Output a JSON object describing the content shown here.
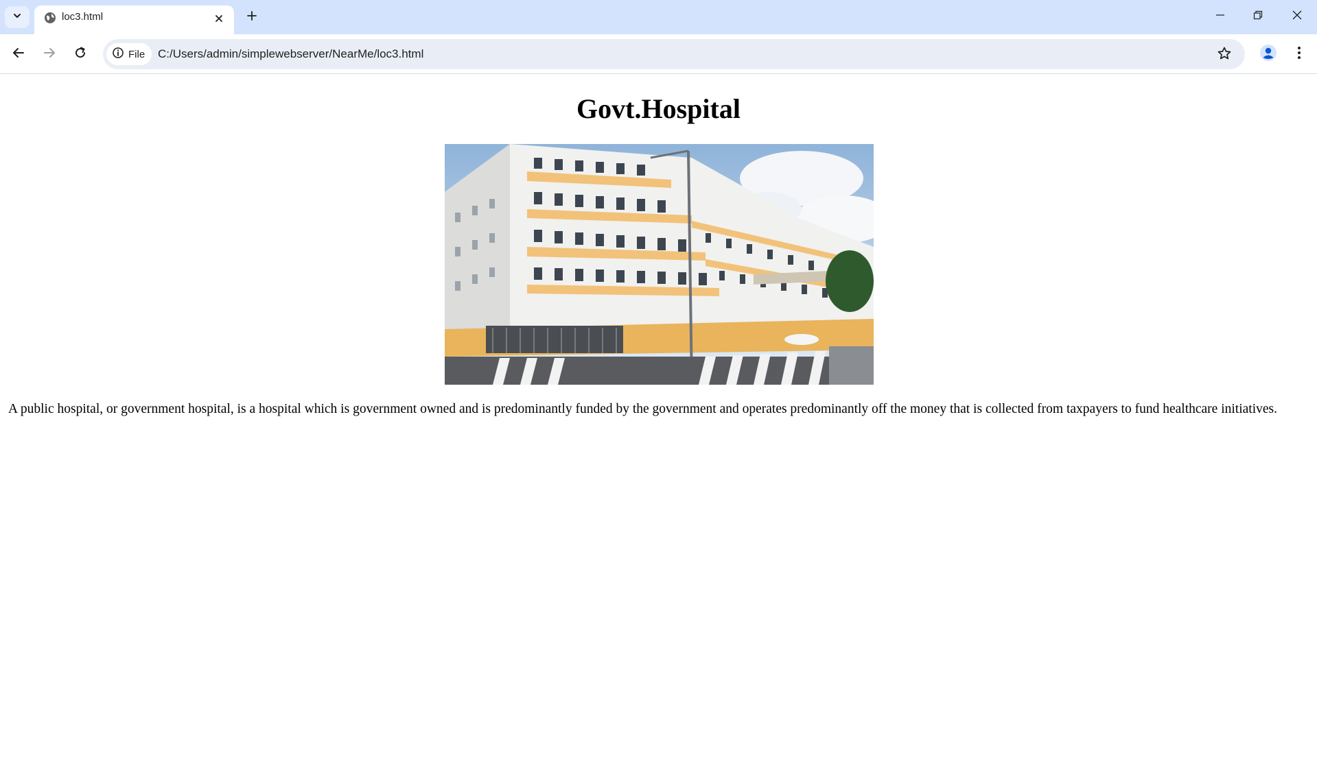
{
  "browser": {
    "tab": {
      "title": "loc3.html"
    },
    "address_bar": {
      "chip_label": "File",
      "url": "C:/Users/admin/simplewebserver/NearMe/loc3.html"
    },
    "icons": {
      "tab_search": "chevron-down-icon",
      "favicon": "globe-icon",
      "tab_close": "close-icon",
      "new_tab": "plus-icon",
      "back": "arrow-left-icon",
      "forward": "arrow-right-icon",
      "reload": "reload-icon",
      "site_info": "info-icon",
      "bookmark": "star-icon",
      "profile": "person-icon",
      "menu": "kebab-menu-icon"
    },
    "colors": {
      "tabstrip": "#d3e3fd",
      "omnibox": "#e9eef6",
      "profile_accent": "#0b57d0"
    }
  },
  "page": {
    "title": "Govt.Hospital",
    "description": "A public hospital, or government hospital, is a hospital which is government owned and is predominantly funded by the government and operates predominantly off the money that is collected from taxpayers to fund healthcare initiatives."
  }
}
